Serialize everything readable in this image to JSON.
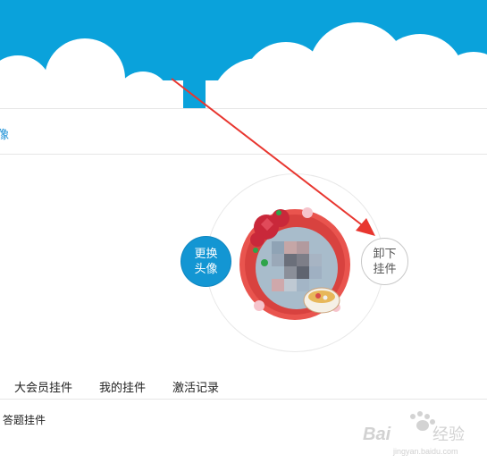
{
  "header": {
    "sky_color": "#0aa2db",
    "cloud_color": "#ffffff"
  },
  "avatar_section": {
    "link_text": "像",
    "change_avatar_line1": "更换",
    "change_avatar_line2": "头像",
    "remove_pendant_line1": "卸下",
    "remove_pendant_line2": "挂件",
    "accent_color": "#1396d3"
  },
  "tabs": [
    {
      "label": "大会员挂件"
    },
    {
      "label": "我的挂件"
    },
    {
      "label": "激活记录"
    }
  ],
  "section": {
    "label": "答题挂件",
    "cut_glyph": ")"
  },
  "annotation": {
    "arrow_color": "#e8362f"
  },
  "watermark": {
    "brand": "Baidu",
    "brand_cn": "经验",
    "url": "jingyan.baidu.com"
  }
}
